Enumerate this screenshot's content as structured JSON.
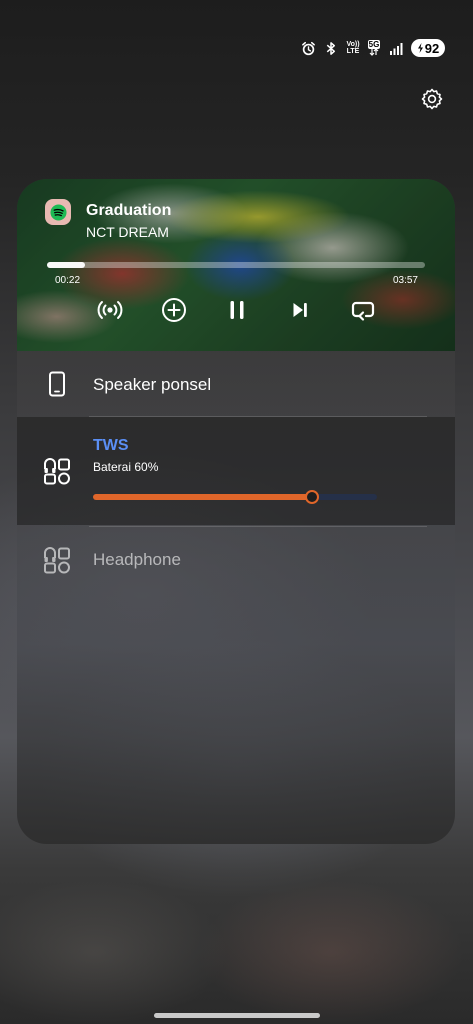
{
  "status_bar": {
    "icons": [
      "alarm-icon",
      "bluetooth-icon",
      "volte-icon",
      "5g-icon",
      "signal-icon"
    ],
    "volte_line1": "Vo))",
    "volte_line2": "LTE",
    "network": "5G",
    "battery": "92"
  },
  "settings": {
    "icon": "gear-icon"
  },
  "media": {
    "app_icon": "spotify-icon",
    "title": "Graduation",
    "artist": "NCT DREAM",
    "elapsed": "00:22",
    "duration": "03:57",
    "progress_fraction": 0.1,
    "controls": [
      "cast-icon",
      "add-icon",
      "pause-icon",
      "next-icon",
      "repeat-icon"
    ]
  },
  "devices": {
    "speaker": {
      "label": "Speaker ponsel",
      "icon": "phone-icon"
    },
    "tws": {
      "name": "TWS",
      "battery": "Baterai 60%",
      "icon": "earbuds-icon",
      "volume_fraction": 0.77,
      "accent": "#5b8ff5",
      "slider_color": "#e0662a"
    },
    "headphone": {
      "label": "Headphone",
      "icon": "earbuds-icon"
    }
  }
}
